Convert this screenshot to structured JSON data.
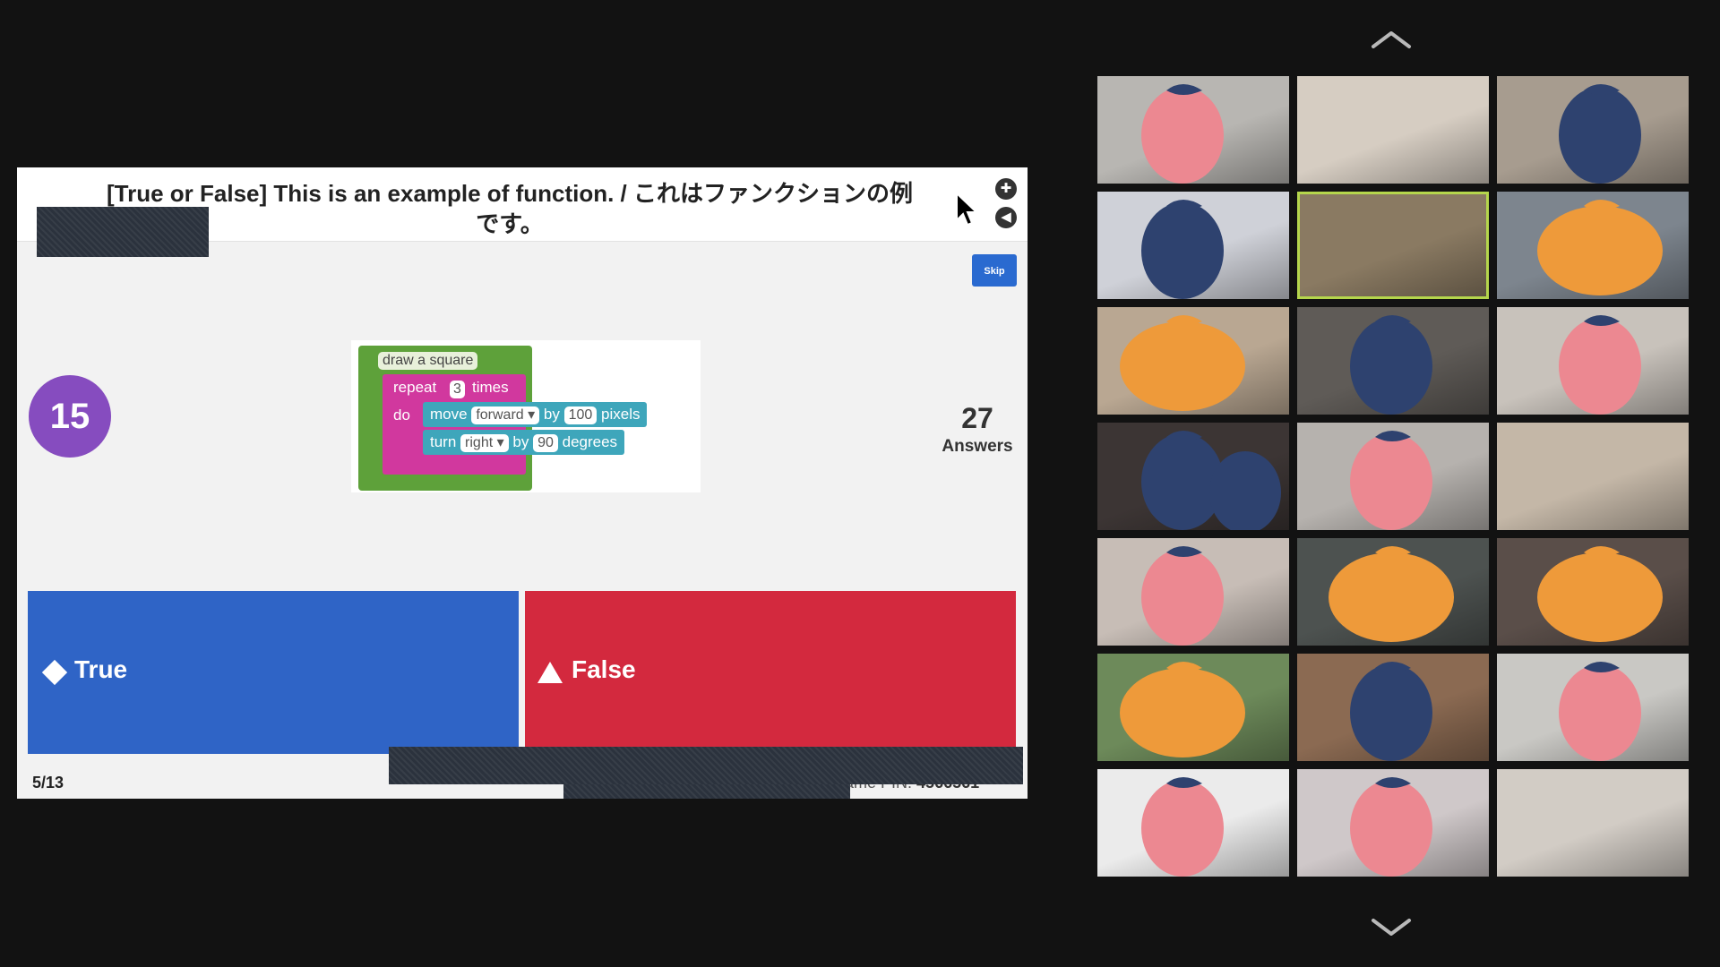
{
  "quiz": {
    "question_line1": "[True or False] This is an example of function. / これはファンクションの例",
    "question_line2": "です。",
    "skip_label": "Skip",
    "timer": "15",
    "answers_count": "27",
    "answers_label": "Answers",
    "options": [
      {
        "label": "True",
        "shape": "diamond",
        "color": "#2f64c6"
      },
      {
        "label": "False",
        "shape": "triangle",
        "color": "#d3293e"
      }
    ],
    "progress": "5/13",
    "game_pin_label": "ame PIN:",
    "game_pin_value": "4566561",
    "controls": [
      "fullscreen-icon",
      "volume-icon"
    ]
  },
  "code_blocks": {
    "define": "draw a square",
    "repeat_word": "repeat",
    "repeat_count": "3",
    "times_word": "times",
    "do_word": "do",
    "move_word": "move",
    "move_dir": "forward ▾",
    "by_word": "by",
    "move_amount": "100",
    "pixels_word": "pixels",
    "turn_word": "turn",
    "turn_dir": "right ▾",
    "turn_amount": "90",
    "degrees_word": "degrees"
  },
  "gallery": {
    "nav_up": "chevron-up-icon",
    "nav_down": "chevron-down-icon",
    "tiles": [
      {
        "bg": "#b8b6b2",
        "cover": "strawberry"
      },
      {
        "bg": "#d6cdc2",
        "cover": "none"
      },
      {
        "bg": "#a79c8f",
        "cover": "navy-fruit"
      },
      {
        "bg": "#cfd1d8",
        "cover": "navy-fruit"
      },
      {
        "bg": "#8a7a62",
        "cover": "none"
      },
      {
        "bg": "#7d858e",
        "cover": "orange"
      },
      {
        "bg": "#b9a792",
        "cover": "orange"
      },
      {
        "bg": "#5f5b57",
        "cover": "navy-fruit"
      },
      {
        "bg": "#c8c2bb",
        "cover": "strawberry"
      },
      {
        "bg": "#3c3534",
        "cover": "navy-fruit-pair"
      },
      {
        "bg": "#b6b2ae",
        "cover": "strawberry"
      },
      {
        "bg": "#c4b7a7",
        "cover": "none"
      },
      {
        "bg": "#c7bdb6",
        "cover": "strawberry"
      },
      {
        "bg": "#4d5250",
        "cover": "orange"
      },
      {
        "bg": "#5a4e49",
        "cover": "orange"
      },
      {
        "bg": "#6d8a5a",
        "cover": "orange"
      },
      {
        "bg": "#8b6a52",
        "cover": "navy-fruit"
      },
      {
        "bg": "#c9c8c4",
        "cover": "strawberry"
      },
      {
        "bg": "#ebebeb",
        "cover": "strawberry"
      },
      {
        "bg": "#cfc8c9",
        "cover": "strawberry"
      },
      {
        "bg": "#d2ccc5",
        "cover": "none"
      }
    ],
    "colors": {
      "strawberry": "#ec8891",
      "orange": "#ee9a3a",
      "navy": "#2e426f",
      "highlight": "#b5d64c"
    }
  }
}
